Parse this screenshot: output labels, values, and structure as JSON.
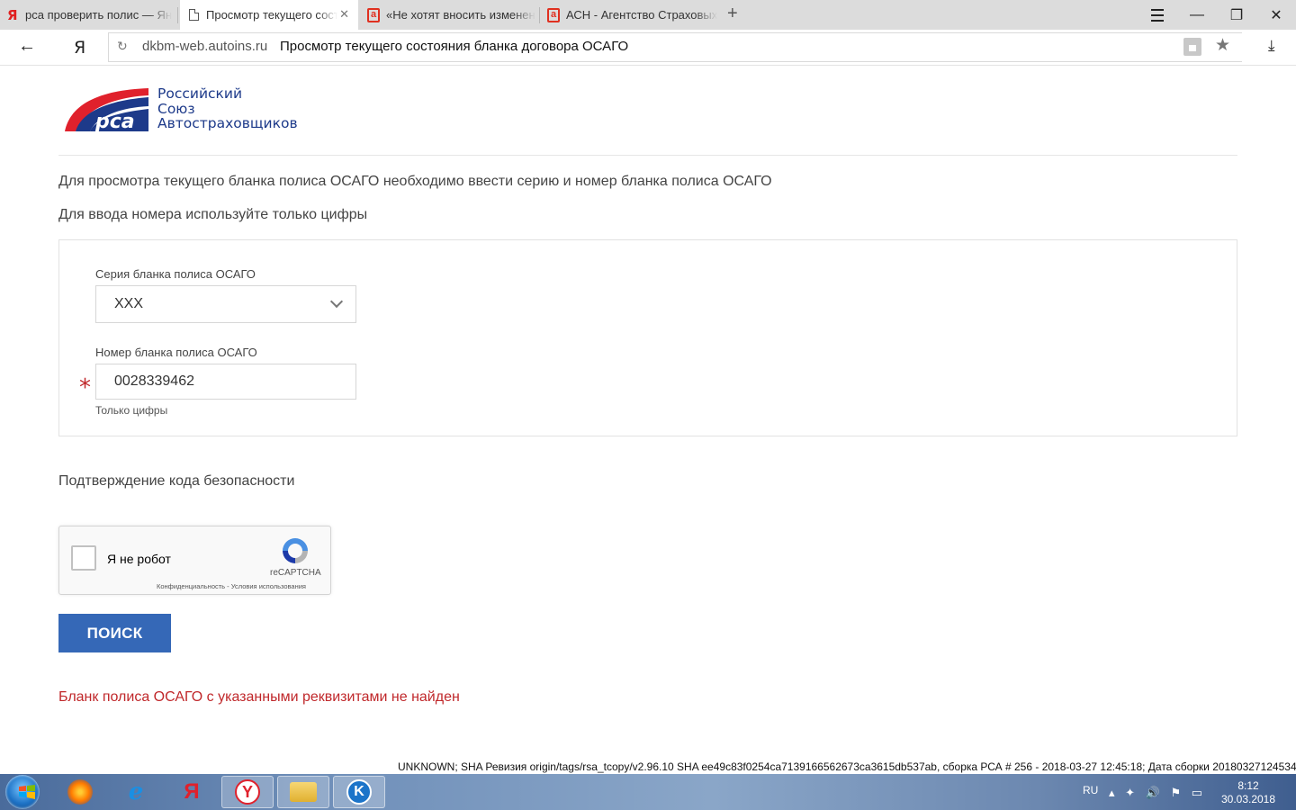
{
  "browser": {
    "tabs": [
      {
        "title": "рса проверить полис — Ян",
        "icon": "yandex-icon"
      },
      {
        "title": "Просмотр текущего сост",
        "icon": "document-icon"
      },
      {
        "title": "«Не хотят вносить изменен",
        "icon": "a-letter-icon"
      },
      {
        "title": "АСН - Агентство Страховых",
        "icon": "a-letter-icon"
      }
    ],
    "ya_button": "Я",
    "domain": "dkbm-web.autoins.ru",
    "page_title": "Просмотр текущего состояния бланка договора ОСАГО"
  },
  "logo": {
    "abbr": "рса",
    "line1": "Российский",
    "line2": "Союз",
    "line3": "Автостраховщиков",
    "colors": {
      "red": "#e0212c",
      "blue": "#1d3a8a"
    }
  },
  "intro": {
    "line1": "Для просмотра текущего бланка полиса ОСАГО необходимо ввести серию и номер бланка полиса ОСАГО",
    "line2": "Для ввода номера используйте только цифры"
  },
  "form": {
    "series_label": "Серия бланка полиса ОСАГО",
    "series_value": "ХХХ",
    "number_label": "Номер бланка полиса ОСАГО",
    "number_value": "0028339462",
    "required_mark": "*",
    "number_hint": "Только цифры"
  },
  "security": {
    "label": "Подтверждение кода безопасности",
    "captcha_label": "Я не робот",
    "captcha_brand": "reCAPTCHA",
    "captcha_terms": "Конфиденциальность - Условия использования"
  },
  "search_button": "Поиск",
  "error_message": "Бланк полиса ОСАГО с указанными реквизитами не найден",
  "build_info": "UNKNOWN; SHA Ревизия origin/tags/rsa_tcopy/v2.96.10 SHA ee49c83f0254ca7139166562673ca3615db537ab, сборка РСА # 256 - 2018-03-27 12:45:18; Дата сборки 20180327124534",
  "taskbar": {
    "apps": [
      "firefox-icon",
      "internet-explorer-icon",
      "yandex-browser-icon",
      "yandex-icon",
      "file-explorer-icon",
      "teamviewer-icon"
    ],
    "language": "RU",
    "time": "8:12",
    "date": "30.03.2018"
  },
  "colors": {
    "accent": "#3568b7",
    "error": "#c0282b"
  }
}
